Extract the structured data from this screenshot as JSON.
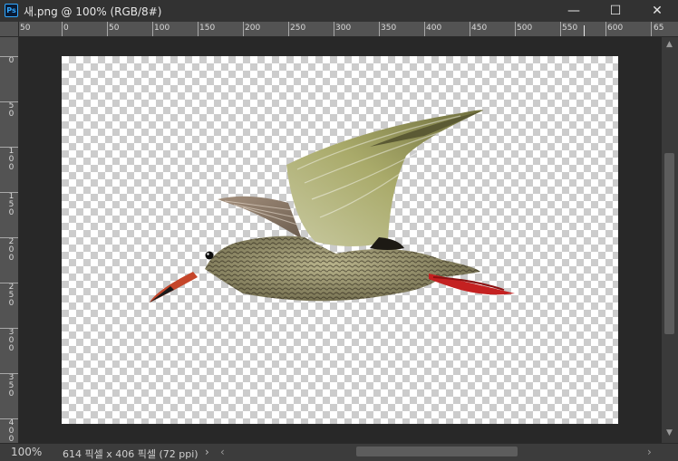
{
  "window": {
    "app_icon": "Ps",
    "title": "새.png @ 100% (RGB/8#)",
    "minimize_glyph": "—",
    "maximize_glyph": "☐",
    "close_glyph": "✕"
  },
  "rulers": {
    "horizontal_labels": [
      "50",
      "0",
      "50",
      "100",
      "150",
      "200",
      "250",
      "300",
      "350",
      "400",
      "450",
      "500",
      "550",
      "600",
      "65"
    ],
    "vertical_labels": [
      "0",
      "50",
      "100",
      "150",
      "200",
      "250",
      "300",
      "350",
      "400"
    ]
  },
  "document": {
    "content": "bird-in-flight-cutout",
    "background": "transparent-checkerboard"
  },
  "status": {
    "zoom": "100%",
    "doc_info": "614 픽셀 x 406 픽셀 (72 ppi)",
    "expand_glyph": "›"
  },
  "scrollbars": {
    "left_arrow": "‹",
    "right_arrow": "›",
    "up_arrow": "▲",
    "down_arrow": "▼"
  }
}
